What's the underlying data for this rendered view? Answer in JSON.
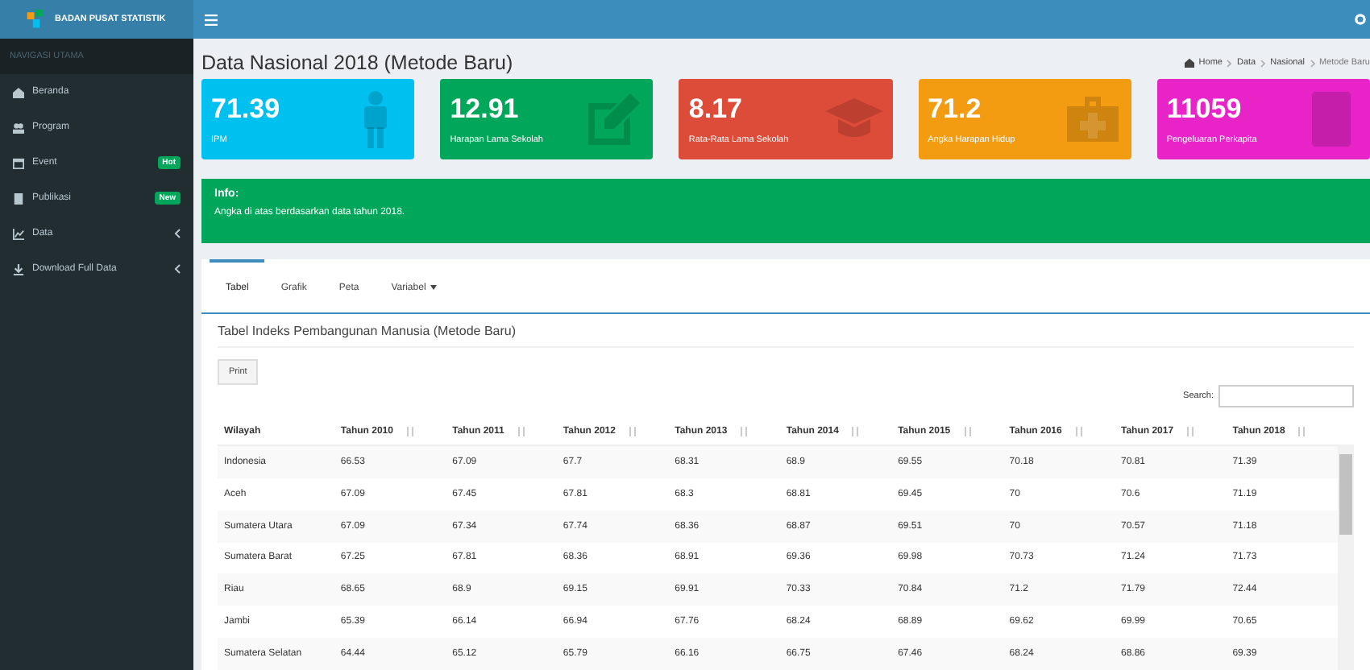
{
  "brand": {
    "name": "BADAN PUSAT STATISTIK"
  },
  "sidebar": {
    "header": "NAVIGASI UTAMA",
    "items": [
      {
        "label": "Beranda",
        "chevron": false
      },
      {
        "label": "Program",
        "chevron": false
      },
      {
        "label": "Event",
        "badge": "Hot",
        "chevron": false
      },
      {
        "label": "Publikasi",
        "badge": "New",
        "chevron": false
      },
      {
        "label": "Data",
        "chevron": true
      },
      {
        "label": "Download Full Data",
        "chevron": true
      }
    ]
  },
  "page": {
    "title": "Data Nasional 2018 (Metode Baru)",
    "breadcrumb": [
      "Home",
      "Data",
      "Nasional",
      "Metode Baru"
    ]
  },
  "cards": [
    {
      "value": "71.39",
      "label": "IPM",
      "color": "#00c0ef"
    },
    {
      "value": "12.91",
      "label": "Harapan Lama Sekolah",
      "color": "#00a65a"
    },
    {
      "value": "8.17",
      "label": "Rata-Rata Lama Sekolah",
      "color": "#dd4b39"
    },
    {
      "value": "71.2",
      "label": "Angka Harapan Hidup",
      "color": "#f39c12"
    },
    {
      "value": "11059",
      "label": "Pengeluaran Perkapita",
      "color": "#e824c8"
    }
  ],
  "info": {
    "title": "Info:",
    "text": "Angka di atas berdasarkan data tahun 2018."
  },
  "tabs": [
    {
      "label": "Tabel",
      "selected": true,
      "dropdown": false
    },
    {
      "label": "Grafik",
      "selected": false,
      "dropdown": false
    },
    {
      "label": "Peta",
      "selected": false,
      "dropdown": false
    },
    {
      "label": "Variabel",
      "selected": false,
      "dropdown": true
    }
  ],
  "table": {
    "title": "Tabel Indeks Pembangunan Manusia (Metode Baru)",
    "print": "Print",
    "search_label": "Search:",
    "columns": [
      "Wilayah",
      "Tahun 2010",
      "Tahun 2011",
      "Tahun 2012",
      "Tahun 2013",
      "Tahun 2014",
      "Tahun 2015",
      "Tahun 2016",
      "Tahun 2017",
      "Tahun 2018"
    ],
    "rows": [
      [
        "Indonesia",
        "66.53",
        "67.09",
        "67.7",
        "68.31",
        "68.9",
        "69.55",
        "70.18",
        "70.81",
        "71.39"
      ],
      [
        "Aceh",
        "67.09",
        "67.45",
        "67.81",
        "68.3",
        "68.81",
        "69.45",
        "70",
        "70.6",
        "71.19"
      ],
      [
        "Sumatera Utara",
        "67.09",
        "67.34",
        "67.74",
        "68.36",
        "68.87",
        "69.51",
        "70",
        "70.57",
        "71.18"
      ],
      [
        "Sumatera Barat",
        "67.25",
        "67.81",
        "68.36",
        "68.91",
        "69.36",
        "69.98",
        "70.73",
        "71.24",
        "71.73"
      ],
      [
        "Riau",
        "68.65",
        "68.9",
        "69.15",
        "69.91",
        "70.33",
        "70.84",
        "71.2",
        "71.79",
        "72.44"
      ],
      [
        "Jambi",
        "65.39",
        "66.14",
        "66.94",
        "67.76",
        "68.24",
        "68.89",
        "69.62",
        "69.99",
        "70.65"
      ],
      [
        "Sumatera Selatan",
        "64.44",
        "65.12",
        "65.79",
        "66.16",
        "66.75",
        "67.46",
        "68.24",
        "68.86",
        "69.39"
      ]
    ]
  }
}
